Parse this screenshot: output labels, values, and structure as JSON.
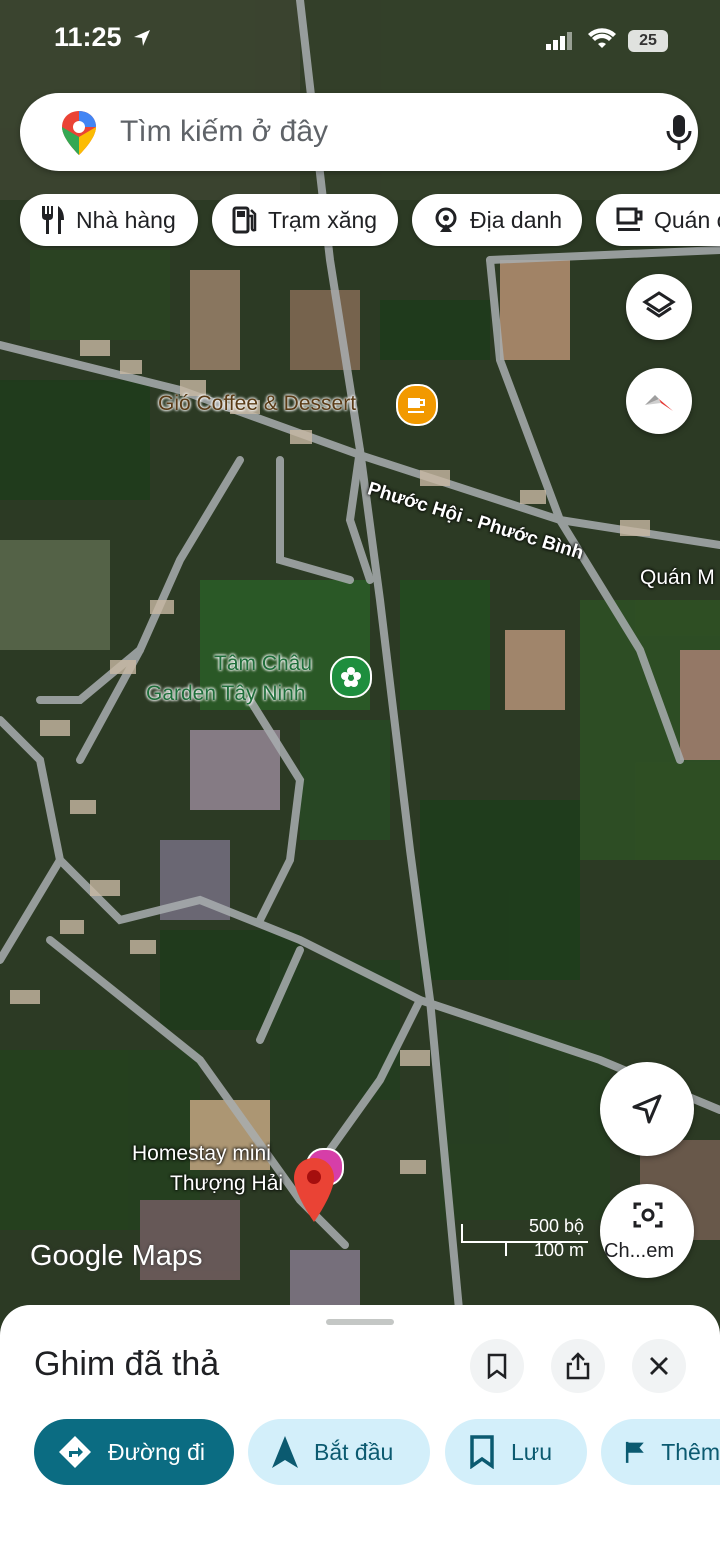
{
  "status_bar": {
    "time": "11:25",
    "battery": "25"
  },
  "search": {
    "placeholder": "Tìm kiếm ở đây"
  },
  "chips": [
    {
      "label": "Nhà hàng",
      "icon": "restaurant-icon"
    },
    {
      "label": "Trạm xăng",
      "icon": "gas-station-icon"
    },
    {
      "label": "Địa danh",
      "icon": "landmark-icon"
    },
    {
      "label": "Quán c",
      "icon": "coffee-icon"
    }
  ],
  "map": {
    "places": [
      {
        "name": "Gió Coffee & Dessert",
        "icon": "coffee-icon",
        "color": "#f29900"
      },
      {
        "name_line1": "Tâm Châu",
        "name_line2": "Garden Tây Ninh",
        "icon": "garden-icon",
        "color": "#1e8e3e"
      },
      {
        "name": "Quán M"
      },
      {
        "name_line1": "Homestay mini",
        "name_line2": "Thượng Hải",
        "color": "#d63ea8"
      }
    ],
    "road": "Phước Hội - Phước Bình",
    "scale": {
      "imperial": "500 bộ",
      "metric": "100 m"
    },
    "logo": "Google Maps",
    "lens_label": "Ch...em",
    "dropped_pin_color": "#ea4335"
  },
  "sheet": {
    "title": "Ghim đã thả",
    "actions": [
      {
        "label": "Đường đi",
        "icon": "directions-icon"
      },
      {
        "label": "Bắt đầu",
        "icon": "navigation-arrow-icon"
      },
      {
        "label": "Lưu",
        "icon": "bookmark-icon"
      },
      {
        "label": "Thêm",
        "icon": "flag-icon"
      }
    ]
  },
  "colors": {
    "primary": "#0b6c82",
    "tonal": "#d3effa"
  }
}
